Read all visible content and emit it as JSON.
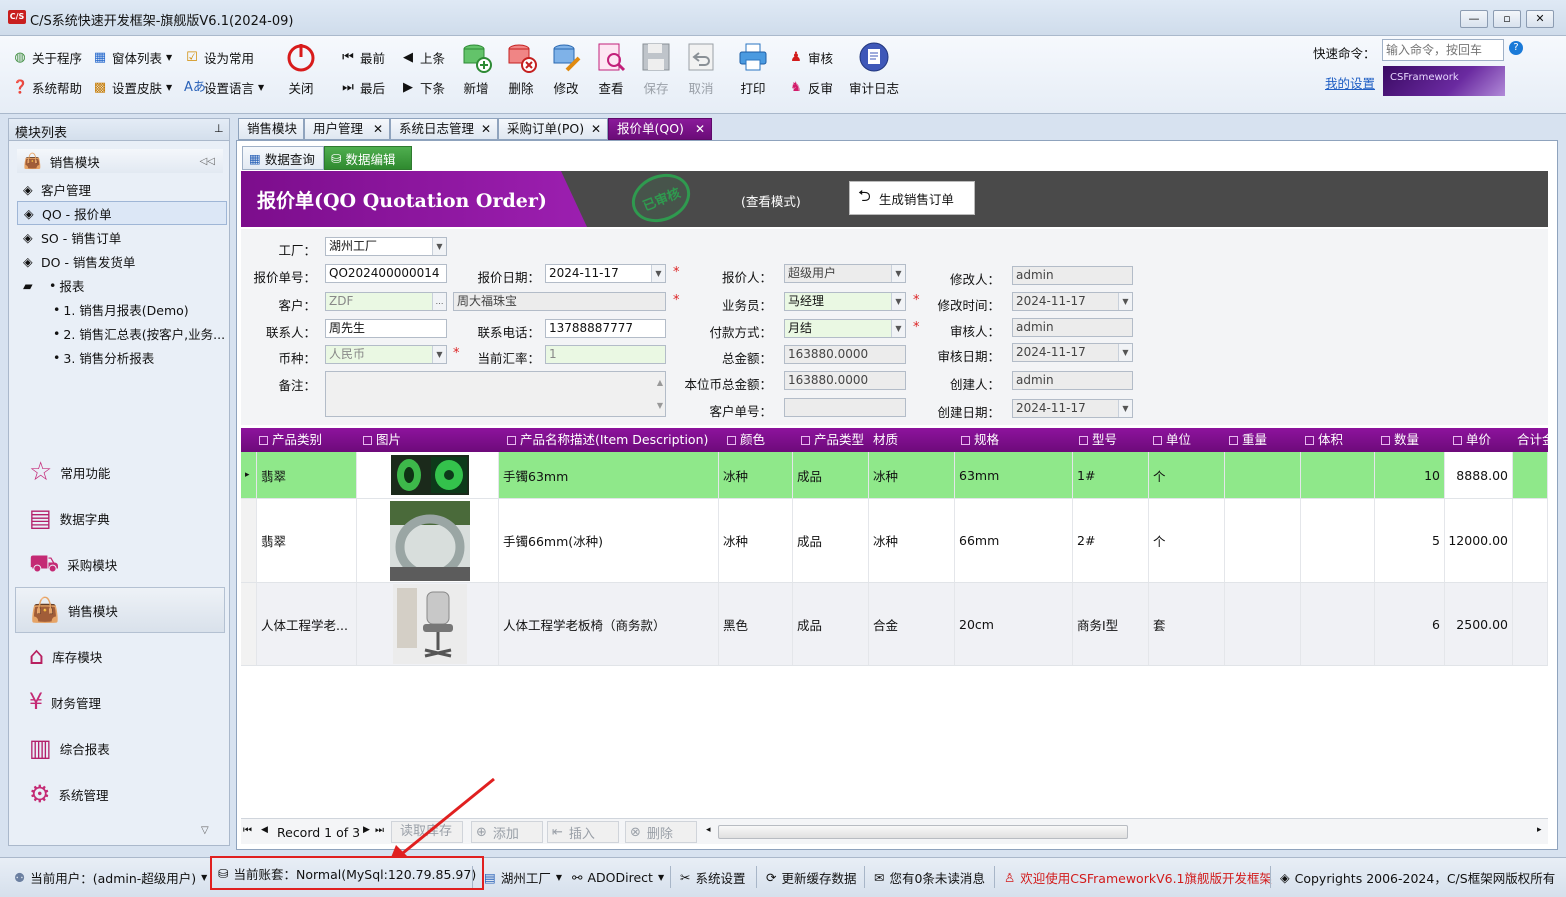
{
  "window": {
    "title": "C/S系统快速开发框架-旗舰版V6.1(2024-09)",
    "logo": "C/S"
  },
  "ribbon": {
    "about": "关于程序",
    "window_list": "窗体列表",
    "set_common": "设为常用",
    "help": "系统帮助",
    "skin": "设置皮肤",
    "language": "设置语言",
    "close": "关闭",
    "first": "最前",
    "prev": "上条",
    "last": "最后",
    "next": "下条",
    "add": "新增",
    "delete": "删除",
    "edit": "修改",
    "view": "查看",
    "save": "保存",
    "cancel": "取消",
    "print": "打印",
    "approve": "审核",
    "unapprove": "反审",
    "audit_log": "审计日志",
    "quick_cmd_label": "快速命令：",
    "quick_cmd_placeholder": "输入命令，按回车",
    "my_settings": "我的设置",
    "brand": "CSFramework"
  },
  "left_panel": {
    "header": "模块列表",
    "group": "销售模块",
    "tree": [
      "客户管理",
      "QO - 报价单",
      "SO - 销售订单",
      "DO - 销售发货单",
      "报表",
      "1. 销售月报表(Demo)",
      "2. 销售汇总表(按客户,业务...",
      "3. 销售分析报表"
    ],
    "nav": [
      "常用功能",
      "数据字典",
      "采购模块",
      "销售模块",
      "库存模块",
      "财务管理",
      "综合报表",
      "系统管理"
    ]
  },
  "tabs": [
    "销售模块",
    "用户管理",
    "系统日志管理",
    "采购订单(PO)",
    "报价单(QO)"
  ],
  "subtabs": [
    "数据查询",
    "数据编辑"
  ],
  "form": {
    "title": "报价单(QO Quotation Order)",
    "stamp": "已审核",
    "mode": "(查看模式)",
    "gen_button": "生成销售订单",
    "factory_label": "工厂：",
    "factory": "湖州工厂",
    "qo_no_label": "报价单号：",
    "qo_no": "QO202400000014",
    "qo_date_label": "报价日期：",
    "qo_date": "2024-11-17",
    "customer_label": "客户：",
    "customer_code": "ZDF",
    "customer_name": "周大福珠宝",
    "contact_label": "联系人：",
    "contact": "周先生",
    "phone_label": "联系电话：",
    "phone": "13788887777",
    "currency_label": "币种：",
    "currency": "人民币",
    "rate_label": "当前汇率：",
    "rate": "1",
    "remark_label": "备注：",
    "quoter_label": "报价人：",
    "quoter": "超级用户",
    "sales_label": "业务员：",
    "sales": "马经理",
    "pay_label": "付款方式：",
    "pay": "月结",
    "total_label": "总金额：",
    "total": "163880.0000",
    "local_total_label": "本位币总金额：",
    "local_total": "163880.0000",
    "cust_order_label": "客户单号：",
    "modifier_label": "修改人：",
    "modifier": "admin",
    "modify_time_label": "修改时间：",
    "modify_time": "2024-11-17",
    "auditor_label": "审核人：",
    "auditor": "admin",
    "audit_date_label": "审核日期：",
    "audit_date": "2024-11-17",
    "creator_label": "创建人：",
    "creator": "admin",
    "create_date_label": "创建日期：",
    "create_date": "2024-11-17"
  },
  "grid": {
    "columns": [
      "产品类别",
      "图片",
      "产品名称描述(Item Description)",
      "颜色",
      "产品类型",
      "材质",
      "规格",
      "型号",
      "单位",
      "重量",
      "体积",
      "数量",
      "单价",
      "合计金"
    ],
    "rows": [
      {
        "category": "翡翠",
        "name": "手镯63mm",
        "color": "冰种",
        "type": "成品",
        "material": "冰种",
        "spec": "63mm",
        "model": "1#",
        "unit": "个",
        "qty": "10",
        "price": "8888.00"
      },
      {
        "category": "翡翠",
        "name": "手镯66mm(冰种)",
        "color": "冰种",
        "type": "成品",
        "material": "冰种",
        "spec": "66mm",
        "model": "2#",
        "unit": "个",
        "qty": "5",
        "price": "12000.00"
      },
      {
        "category": "人体工程学老...",
        "name": "人体工程学老板椅（商务款）",
        "color": "黑色",
        "type": "成品",
        "material": "合金",
        "spec": "20cm",
        "model": "商务I型",
        "unit": "套",
        "qty": "6",
        "price": "2500.00"
      }
    ],
    "nav": {
      "record": "Record 1 of 3",
      "read_stock": "读取库存",
      "add": "添加",
      "insert": "插入",
      "delete": "删除"
    }
  },
  "status": {
    "user": "当前用户：(admin-超级用户)",
    "account": "当前账套：Normal(MySql:120.79.85.97)",
    "factory": "湖州工厂",
    "conn": "ADODirect",
    "settings": "系统设置",
    "refresh": "更新缓存数据",
    "messages": "您有0条未读消息",
    "welcome": "欢迎使用CSFrameworkV6.1旗舰版开发框架",
    "copyright": "Copyrights 2006-2024，C/S框架网版权所有"
  },
  "colors": {
    "header_purple": "#7a0f88",
    "row_green": "#8fe88a",
    "accent_red": "#e02020"
  }
}
